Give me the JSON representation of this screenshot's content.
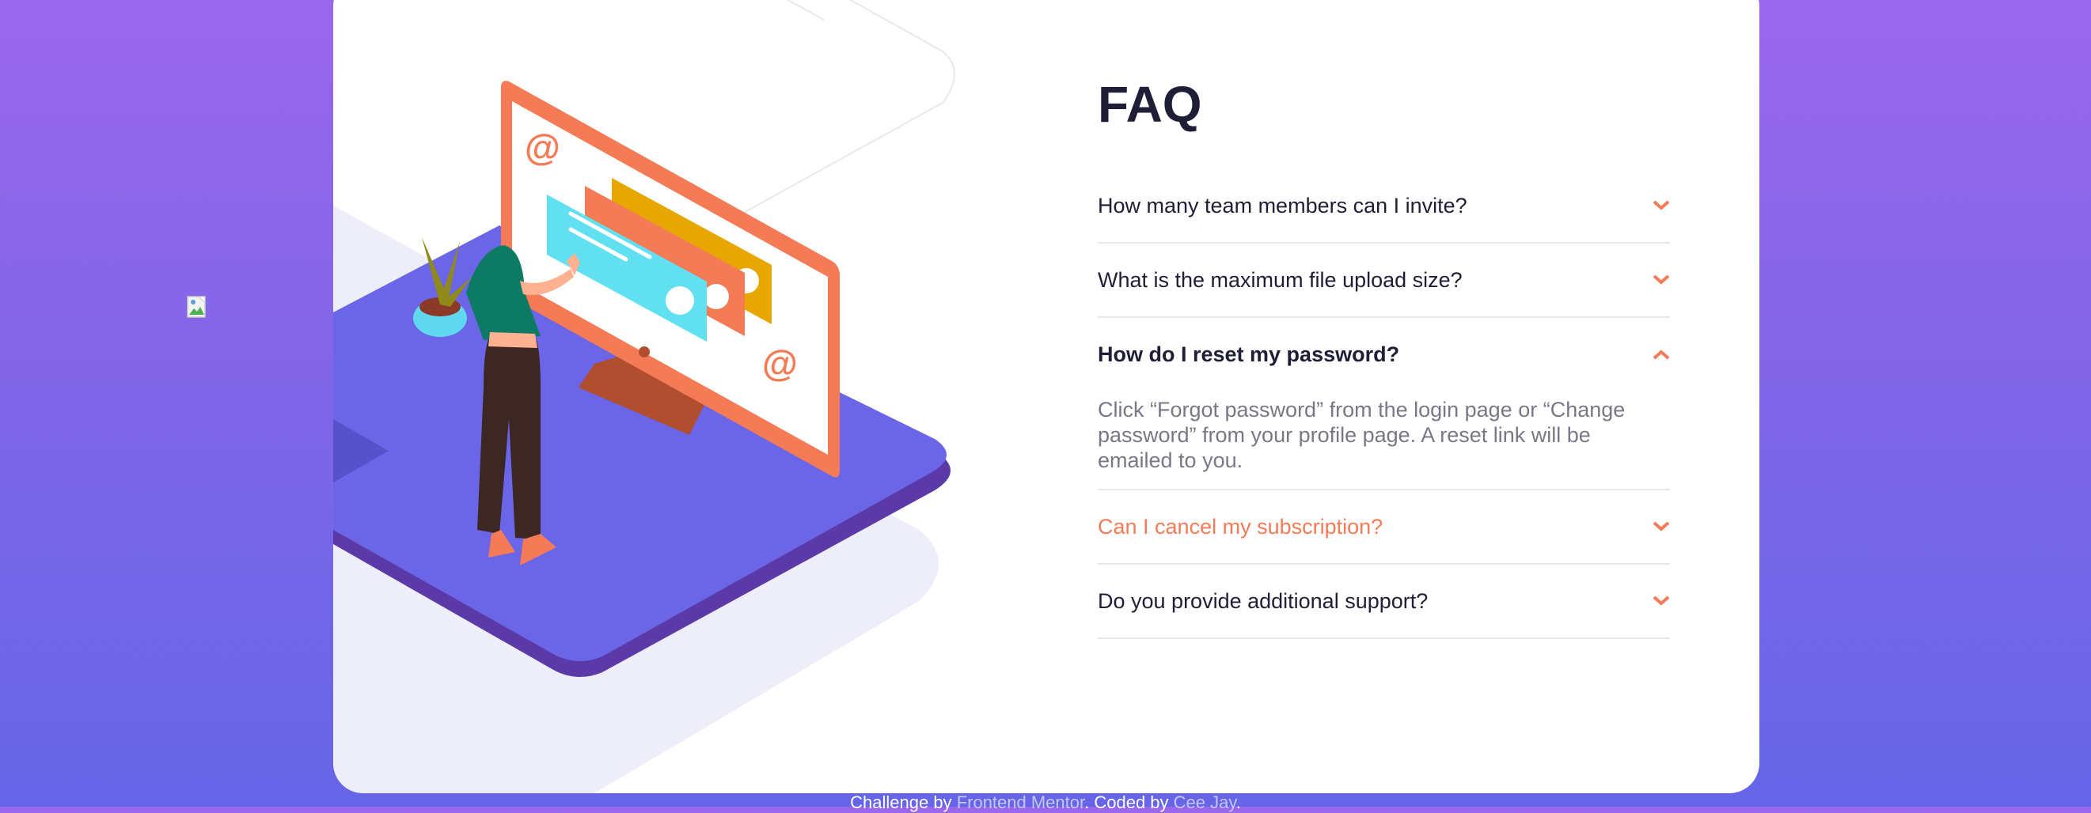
{
  "faq": {
    "title": "FAQ",
    "items": [
      {
        "question": "How many team members can I invite?",
        "state": "closed"
      },
      {
        "question": "What is the maximum file upload size?",
        "state": "closed"
      },
      {
        "question": "How do I reset my password?",
        "state": "open",
        "answer": "Click “Forgot password” from the login page or “Change password” from your profile page. A reset link will be emailed to you."
      },
      {
        "question": "Can I cancel my subscription?",
        "state": "hover"
      },
      {
        "question": "Do you provide additional support?",
        "state": "closed"
      }
    ],
    "chevron_icon": "chevron-down-icon"
  },
  "attribution": {
    "challenge_prefix": "Challenge by",
    "challenge_link": "Frontend Mentor",
    "coded_prefix": "Coded by",
    "coded_link": "Cee Jay"
  },
  "colors": {
    "background_top": "#9a67ea",
    "background_bottom": "#6565e7",
    "accent": "#f47b56",
    "heading": "#1e1f36",
    "answer_text": "#787887"
  }
}
